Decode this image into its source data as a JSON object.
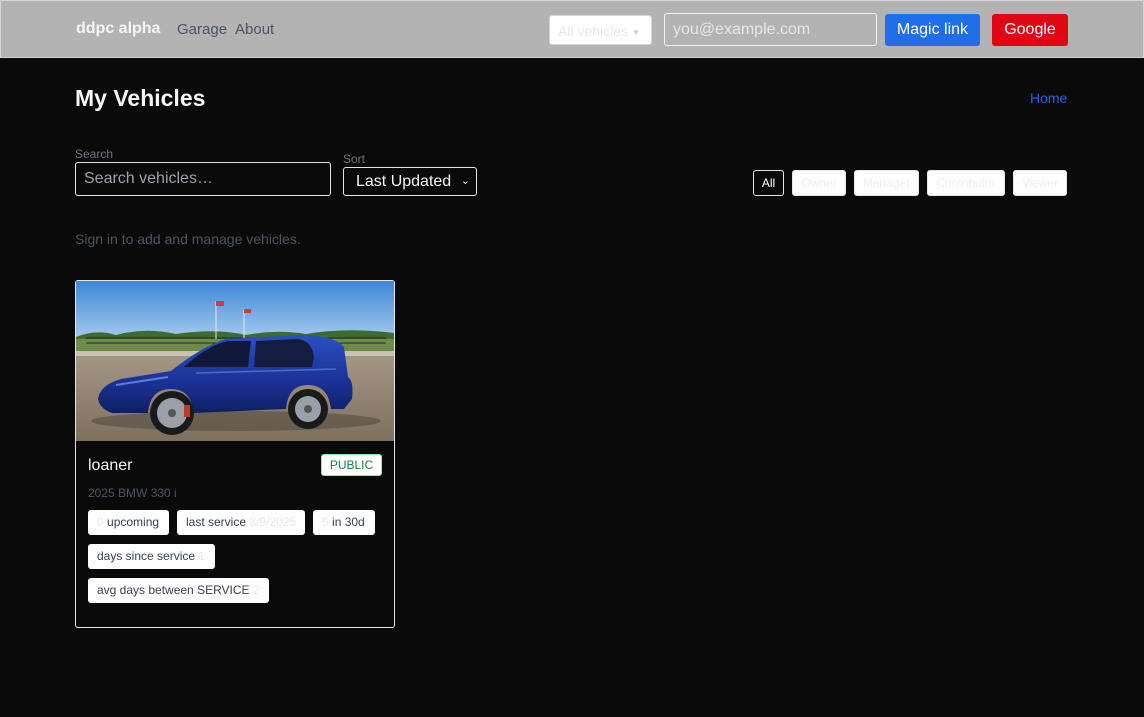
{
  "header": {
    "brand": "ddpc alpha",
    "nav": {
      "garage": "Garage",
      "about": "About"
    },
    "vehicle_filter": "All vehicles",
    "email_placeholder": "you@example.com",
    "magic_link_label": "Magic link",
    "google_label": "Google"
  },
  "page": {
    "title": "My Vehicles",
    "home_link": "Home"
  },
  "filters": {
    "search_label": "Search",
    "search_placeholder": "Search vehicles…",
    "sort_label": "Sort",
    "sort_value": "Last Updated",
    "roles": [
      "All",
      "Owner",
      "Manager",
      "Contributor",
      "Viewer"
    ],
    "active_role": "All"
  },
  "signin_note": "Sign in to add and manage vehicles.",
  "vehicles": [
    {
      "name": "loaner",
      "visibility": "PUBLIC",
      "subtitle": "2025 BMW 330 i",
      "stats": {
        "upcoming_count": "0",
        "upcoming_label": "upcoming",
        "last_service_label": "last service",
        "last_service_value": "8/9/2025",
        "in30_count": "5",
        "in30_label": "in 30d",
        "days_since_label": "days since service",
        "days_since_value": "1",
        "avg_label": "avg days between SERVICE",
        "avg_value": "2"
      }
    }
  ],
  "colors": {
    "background": "#0a0a0a",
    "header_bg": "#b3b3b3",
    "magic_link": "#1f6feb",
    "google": "#e00613",
    "link": "#2563eb",
    "public_badge": "#15803d"
  }
}
